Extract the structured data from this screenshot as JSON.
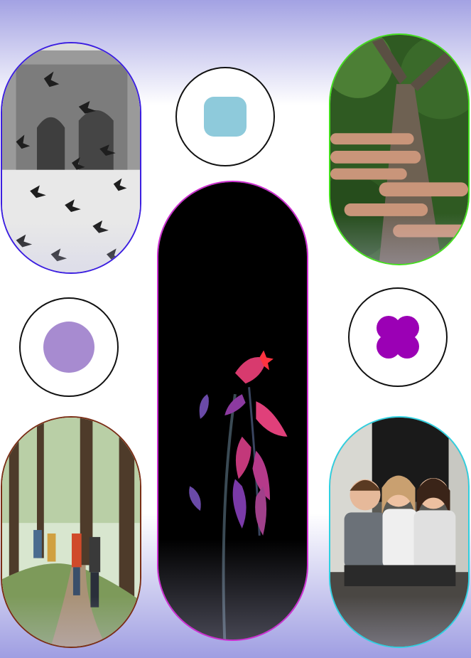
{
  "colors": {
    "background_top": "#a3a2e3",
    "background_bottom": "#9f9ee2",
    "pigeons_border": "#3b1ee0",
    "hands_border": "#45e01e",
    "flower_border": "#cc2dd0",
    "hikers_border": "#7a2e16",
    "kids_border": "#2ed0e0",
    "blue_square": "#8ecadb",
    "purple_circle": "#a78bd0",
    "magenta_clover": "#9b00b5"
  },
  "icons": {
    "rounded_square": "rounded-square-icon",
    "circle": "circle-icon",
    "clover": "clover-icon"
  },
  "photos": {
    "pigeons": "photo-pigeons",
    "hands": "photo-hands-on-tree",
    "flower": "photo-flower",
    "hikers": "photo-hikers",
    "kids": "photo-kids"
  }
}
